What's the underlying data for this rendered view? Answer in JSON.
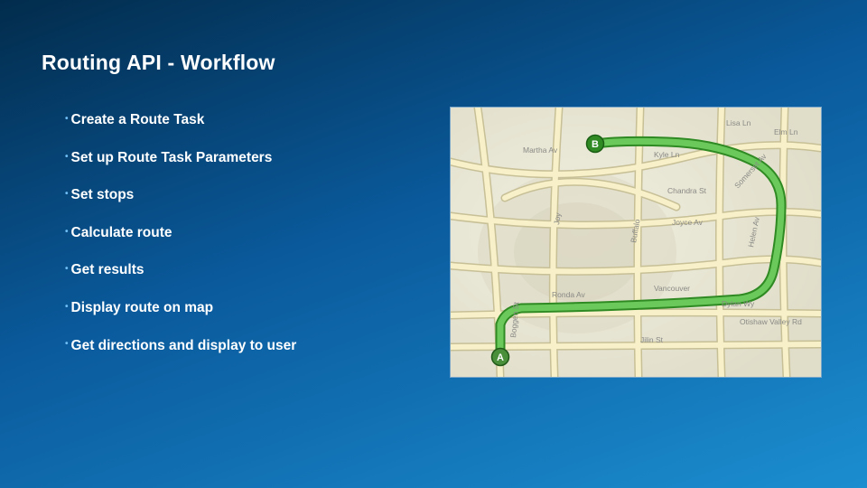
{
  "title": "Routing API - Workflow",
  "bullets": [
    "Create a Route Task",
    "Set up Route Task Parameters",
    "Set stops",
    "Calculate route",
    "Get results",
    "Display route on map",
    "Get directions and display to user"
  ],
  "map": {
    "marker_a": "A",
    "marker_b": "B",
    "street_labels": [
      "Jilin St",
      "Dylan Wy",
      "Helen Av",
      "Somerset Av",
      "Martha Av",
      "Buffalo",
      "Joy",
      "Joyce Av",
      "Chandra St",
      "Vancouver",
      "Ronda Av",
      "Otishaw Valley Rd",
      "Boggen St",
      "Lisa Ln",
      "Elm Ln",
      "Kyle Ln"
    ]
  },
  "colors": {
    "route": "#5db84a",
    "route_outline": "#2f8a23",
    "road": "#f7f0c8",
    "road_edge": "#c7bf96",
    "marker_b_fill": "#2f8a23",
    "marker_a_fill": "#4a8f3a"
  }
}
